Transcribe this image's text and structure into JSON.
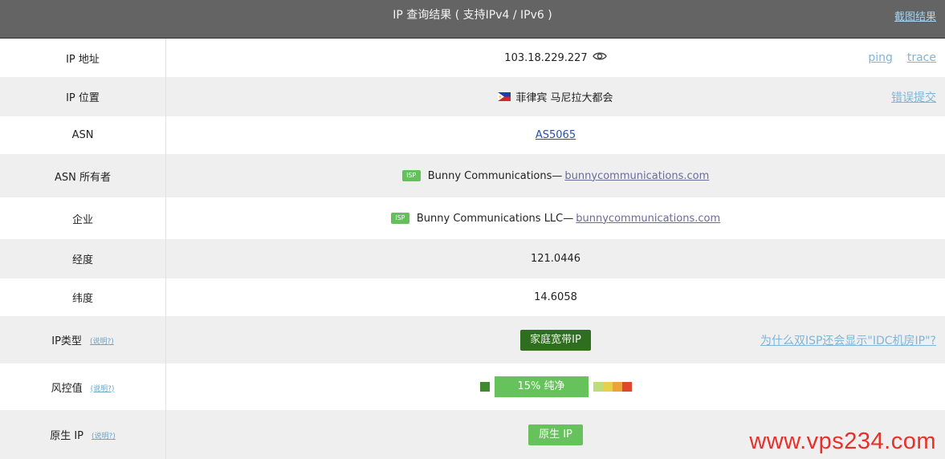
{
  "header": {
    "title": "IP 查询结果 ( 支持IPv4 / IPv6 )",
    "screenshot_link": "截图结果"
  },
  "rows": {
    "ip": {
      "label": "IP 地址",
      "value": "103.18.229.227",
      "links": [
        "ping",
        "trace"
      ]
    },
    "location": {
      "label": "IP 位置",
      "value": "菲律宾 马尼拉大都会",
      "report": "错误提交"
    },
    "asn": {
      "label": "ASN",
      "value": "AS5065"
    },
    "asn_owner": {
      "label": "ASN 所有者",
      "badge": "ISP",
      "name": "Bunny Communications—",
      "domain": "bunnycommunications.com"
    },
    "company": {
      "label": "企业",
      "badge": "ISP",
      "name": "Bunny Communications LLC—",
      "domain": "bunnycommunications.com"
    },
    "longitude": {
      "label": "经度",
      "value": "121.0446"
    },
    "latitude": {
      "label": "纬度",
      "value": "14.6058"
    },
    "ip_type": {
      "label": "IP类型",
      "help": "(说明?)",
      "value": "家庭宽带IP",
      "side_link": "为什么双ISP还会显示\"IDC机房IP\"?"
    },
    "risk": {
      "label": "风控值",
      "help": "(说明?)",
      "value": "15%   纯净",
      "score": 0.15,
      "scale_colors": [
        "#bfdc7a",
        "#e6d24a",
        "#efa23a",
        "#e0462e"
      ]
    },
    "native": {
      "label": "原生 IP",
      "help": "(说明?)",
      "value": "原生 IP"
    }
  },
  "watermark": "www.vps234.com"
}
